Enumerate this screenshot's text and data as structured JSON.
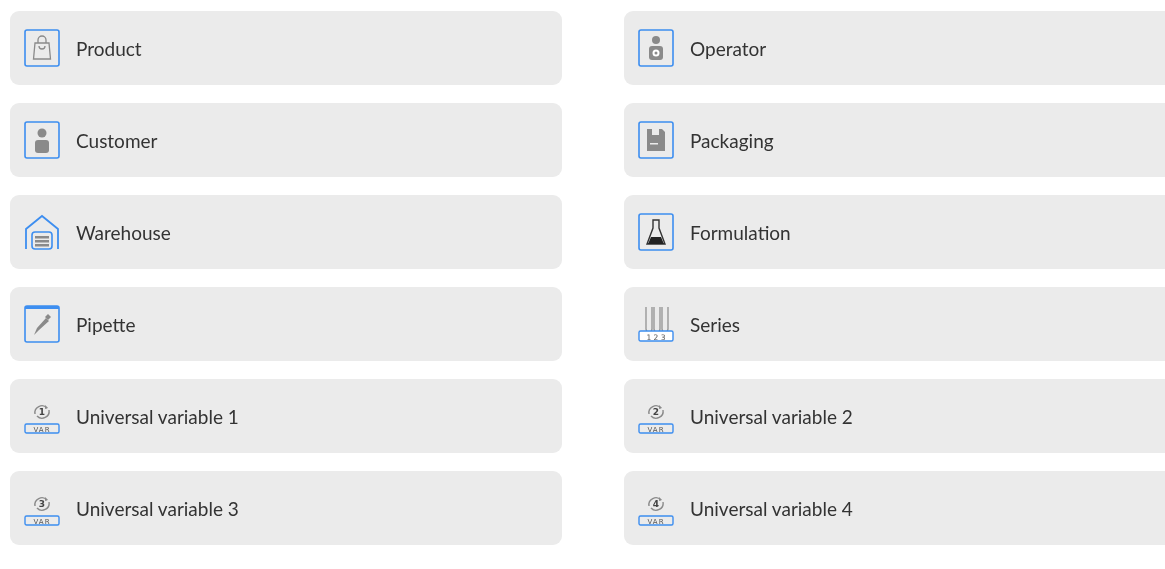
{
  "items": [
    {
      "label": "Product",
      "kind": "bag"
    },
    {
      "label": "Operator",
      "kind": "operator"
    },
    {
      "label": "Customer",
      "kind": "person"
    },
    {
      "label": "Packaging",
      "kind": "package"
    },
    {
      "label": "Warehouse",
      "kind": "warehouse"
    },
    {
      "label": "Formulation",
      "kind": "flask"
    },
    {
      "label": "Pipette",
      "kind": "pipette"
    },
    {
      "label": "Series",
      "kind": "series",
      "icon_text": "1 2 3"
    },
    {
      "label": "Universal variable 1",
      "kind": "variable",
      "icon_number": "1",
      "icon_text": "VAR"
    },
    {
      "label": "Universal variable 2",
      "kind": "variable",
      "icon_number": "2",
      "icon_text": "VAR"
    },
    {
      "label": "Universal variable 3",
      "kind": "variable",
      "icon_number": "3",
      "icon_text": "VAR"
    },
    {
      "label": "Universal variable 4",
      "kind": "variable",
      "icon_number": "4",
      "icon_text": "VAR"
    }
  ]
}
